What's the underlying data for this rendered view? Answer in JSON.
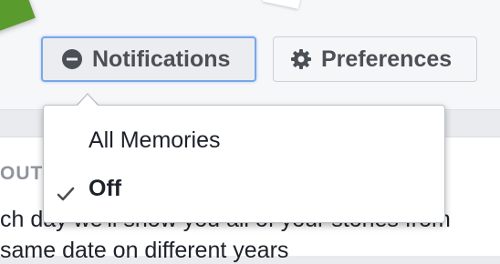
{
  "toolbar": {
    "notifications_label": "Notifications",
    "preferences_label": "Preferences"
  },
  "content": {
    "heading": "OUT",
    "line1": "ch day we'll show you all of your stories from",
    "line2": "same date on different years"
  },
  "dropdown": {
    "items": [
      {
        "label": "All Memories",
        "selected": false
      },
      {
        "label": "Off",
        "selected": true
      }
    ]
  },
  "icons": {
    "notifications": "minus-circle-icon",
    "preferences": "gear-icon",
    "selected": "check-icon"
  },
  "colors": {
    "focus_ring": "#7aa7e8",
    "button_text": "#4b4f56",
    "heading_gray": "#90949c"
  }
}
